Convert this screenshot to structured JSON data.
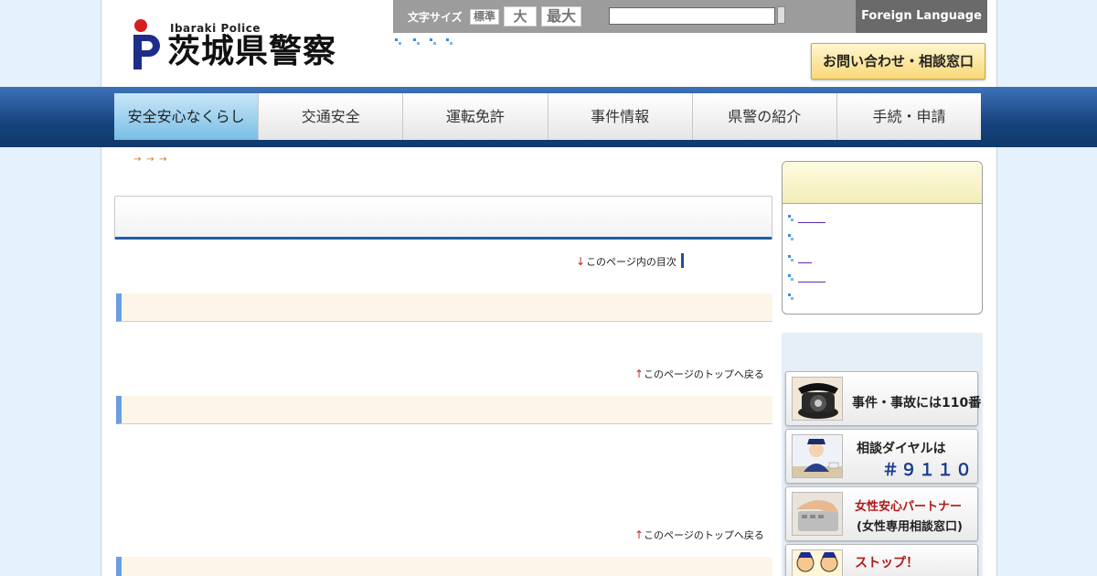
{
  "header": {
    "logo_en": "Ibaraki Police",
    "logo_jp": "茨城県警察",
    "font_size_label": "文字サイズ",
    "font_size_standard": "標準",
    "font_size_large": "大",
    "font_size_max": "最大",
    "search_value": "",
    "foreign_language": "Foreign Language",
    "contact_button": "お問い合わせ・相談窓口"
  },
  "nav": {
    "items": [
      {
        "label": "安全安心なくらし",
        "active": true
      },
      {
        "label": "交通安全",
        "active": false
      },
      {
        "label": "運転免許",
        "active": false
      },
      {
        "label": "事件情報",
        "active": false
      },
      {
        "label": "県警の紹介",
        "active": false
      },
      {
        "label": "手続・申請",
        "active": false
      }
    ]
  },
  "main": {
    "breadcrumb_arrow": "→",
    "toc_arrow": "↓",
    "toc_link": "このページ内の目次",
    "back_arrow": "↑",
    "back_to_top": "このページのトップへ戻る"
  },
  "sidebar": {
    "banners": [
      {
        "line1": "事件・事故には110番",
        "line2": ""
      },
      {
        "line1": "相談ダイヤルは",
        "line2": "＃９１１０"
      },
      {
        "line1": "女性安心パートナー",
        "line2": "(女性専用相談窓口)"
      },
      {
        "line1": "ストップ！",
        "line2": ""
      }
    ]
  },
  "colors": {
    "nav_band": "#16447e",
    "nav_active": "#78bfe6",
    "section_accent": "#6a9ee0",
    "banner_red": "#b01818",
    "banner_blue": "#1a3c8f"
  }
}
